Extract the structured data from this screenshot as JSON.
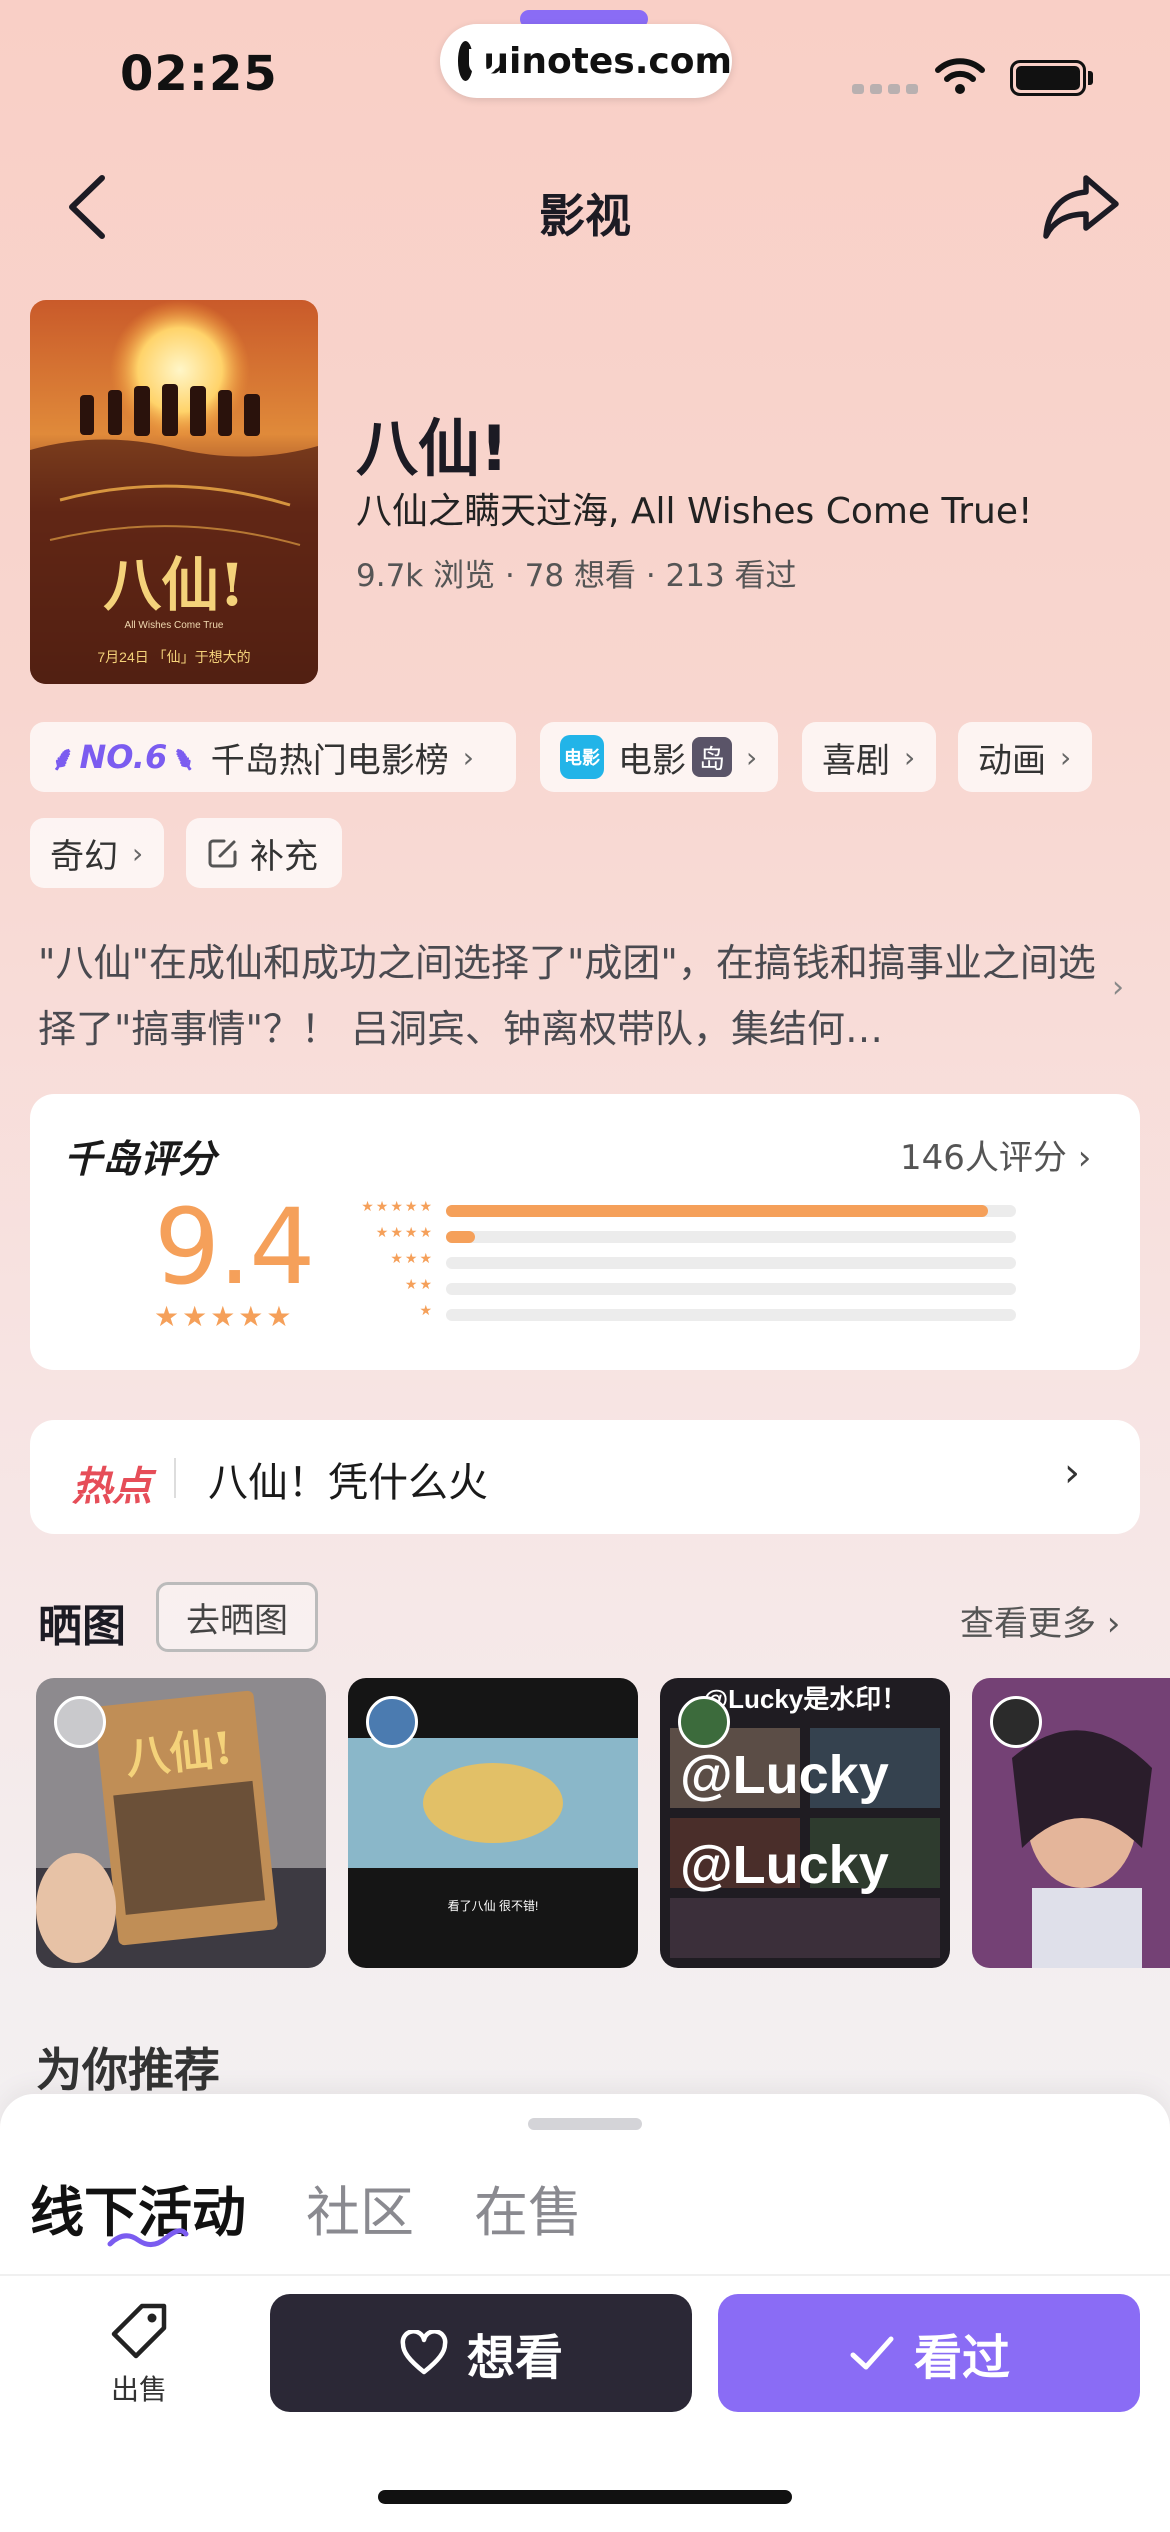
{
  "status_bar": {
    "time": "02:25",
    "watermark": "uinotes.com"
  },
  "nav": {
    "title": "影视"
  },
  "movie": {
    "title": "八仙!",
    "subtitle": "八仙之瞒天过海, All Wishes Come True!",
    "stats": "9.7k 浏览 · 78 想看 · 213 看过",
    "poster": {
      "title": "八仙!",
      "tagline": "All Wishes Come True",
      "date": "7月24日 「仙」于想大的"
    }
  },
  "tags": {
    "rank_no": "NO.6",
    "rank_label": "千岛热门电影榜",
    "film_badge": "电影",
    "film_label": "电影",
    "island_badge": "岛",
    "genre1": "喜剧",
    "genre2": "动画",
    "genre3": "奇幻",
    "supplement": "补充"
  },
  "description": "\"八仙\"在成仙和成功之间选择了\"成团\"，在搞钱和搞事业之间选择了\"搞事情\"？！ 吕洞宾、钟离权带队，集结何…",
  "rating": {
    "title": "千岛评分",
    "count_label": "146人评分",
    "score": "9.4",
    "distribution": [
      0.95,
      0.05,
      0,
      0,
      0
    ],
    "star_labels": [
      "★★★★★",
      "★★★★",
      "★★★",
      "★★",
      "★"
    ],
    "score_stars": "★★★★★"
  },
  "hot": {
    "label": "热点",
    "text": "八仙！凭什么火"
  },
  "photos": {
    "title": "晒图",
    "go_button": "去晒图",
    "see_more": "查看更多",
    "items": [
      {
        "caption": "八仙!"
      },
      {
        "caption": "看了八仙 很不错!"
      },
      {
        "caption": "@Lucky是水印！"
      },
      {
        "caption": ""
      }
    ],
    "watermark_big": "@Lucky"
  },
  "recommend": {
    "title": "为你推荐"
  },
  "bottom": {
    "tabs": [
      "线下活动",
      "社区",
      "在售"
    ],
    "sell_label": "出售",
    "want_label": "想看",
    "seen_label": "看过"
  },
  "colors": {
    "accent": "#8a6cf5",
    "rating": "#f5a05a",
    "hot": "#e64d58",
    "dark_button": "#2b2836"
  }
}
